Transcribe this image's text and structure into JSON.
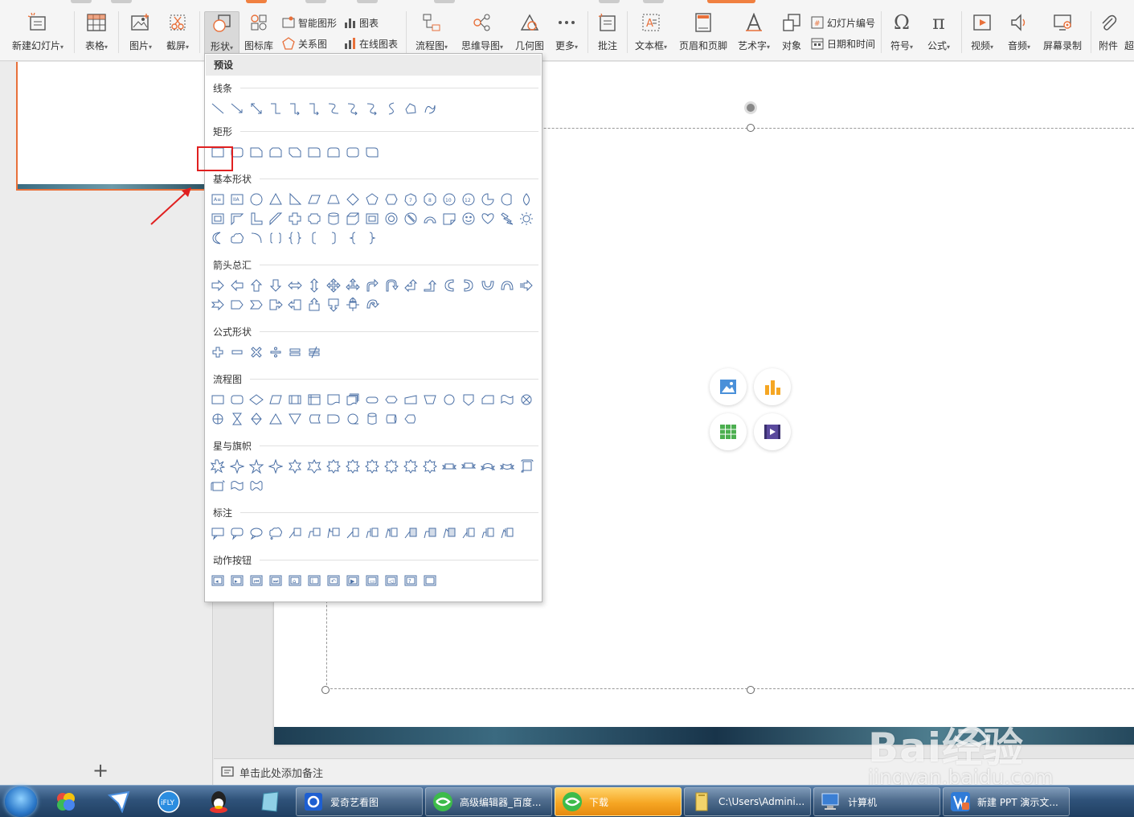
{
  "ribbon": {
    "buttons": {
      "new_slide": "新建幻灯片",
      "table": "表格",
      "picture": "图片",
      "screenshot": "截屏",
      "shape": "形状",
      "icon_lib": "图标库",
      "flowchart": "流程图",
      "mindmap": "思维导图",
      "geometry": "几何图",
      "more": "更多",
      "comment": "批注",
      "textbox": "文本框",
      "header_footer": "页眉和页脚",
      "wordart": "艺术字",
      "object": "对象",
      "symbol": "符号",
      "formula": "公式",
      "video": "视频",
      "audio": "音频",
      "screen_record": "屏幕录制",
      "attachment": "附件",
      "overflow": "超"
    },
    "small": {
      "smart_shape": "智能图形",
      "chart": "图表",
      "relation": "关系图",
      "online_chart": "在线图表",
      "slide_number": "幻灯片编号",
      "date_time": "日期和时间"
    },
    "dropdown_marker": "▾"
  },
  "shapes_panel": {
    "header": "预设",
    "categories": {
      "lines": "线条",
      "rectangles": "矩形",
      "basic": "基本形状",
      "arrows": "箭头总汇",
      "equation": "公式形状",
      "flowchart": "流程图",
      "stars": "星与旗帜",
      "callouts": "标注",
      "actions": "动作按钮"
    }
  },
  "left_pane": {
    "add_slide": "+"
  },
  "notes": {
    "placeholder": "单击此处添加备注"
  },
  "watermark": {
    "brand": "Bai经验",
    "url": "jingyan.baidu.com"
  },
  "taskbar": {
    "items": {
      "iqiyi": "爱奇艺看图",
      "editor": "高级编辑器_百度...",
      "download": "下载",
      "folder": "C:\\Users\\Admini...",
      "computer": "计算机",
      "ppt": "新建 PPT 演示文..."
    }
  },
  "colors": {
    "accent": "#e8703a",
    "shape_stroke": "#4a6fa5",
    "highlight": "#e02020"
  }
}
